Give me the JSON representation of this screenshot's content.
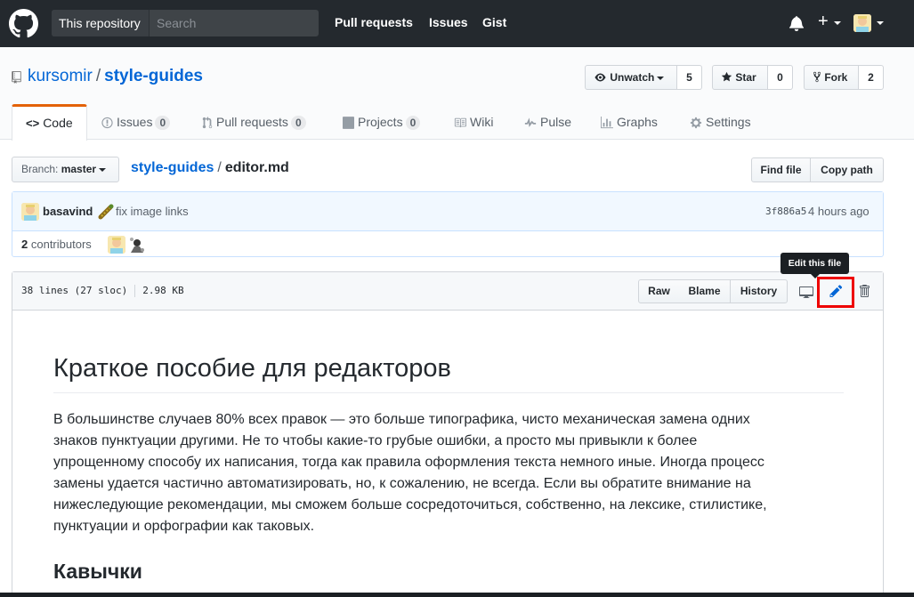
{
  "header": {
    "search_scope": "This repository",
    "search_placeholder": "Search",
    "nav": [
      "Pull requests",
      "Issues",
      "Gist"
    ],
    "plus_label": "+"
  },
  "repo": {
    "owner": "kursomir",
    "separator": "/",
    "name": "style-guides",
    "watch_label": "Unwatch",
    "watch_count": "5",
    "star_label": "Star",
    "star_count": "0",
    "fork_label": "Fork",
    "fork_count": "2"
  },
  "tabs": [
    {
      "label": "Code",
      "icon": "code-icon"
    },
    {
      "label": "Issues",
      "count": "0",
      "icon": "issue-icon"
    },
    {
      "label": "Pull requests",
      "count": "0",
      "icon": "pull-request-icon"
    },
    {
      "label": "Projects",
      "count": "0",
      "icon": "project-icon"
    },
    {
      "label": "Wiki",
      "icon": "book-icon"
    },
    {
      "label": "Pulse",
      "icon": "pulse-icon"
    },
    {
      "label": "Graphs",
      "icon": "graph-icon"
    },
    {
      "label": "Settings",
      "icon": "gear-icon"
    }
  ],
  "file_nav": {
    "branch_prefix": "Branch:",
    "branch": "master",
    "repo": "style-guides",
    "separator": "/",
    "file": "editor.md",
    "find_file": "Find file",
    "copy_path": "Copy path"
  },
  "commit": {
    "author": "basavind",
    "message": "fix image links",
    "sha": "3f886a5",
    "time": "4 hours ago",
    "contributors_count": "2",
    "contributors_label": "contributors"
  },
  "file": {
    "lines": "38 lines (27 sloc)",
    "size": "2.98 KB",
    "raw": "Raw",
    "blame": "Blame",
    "history": "History",
    "tooltip": "Edit this file"
  },
  "markdown": {
    "h1": "Краткое пособие для редакторов",
    "p1_lines": [
      "В большинстве случаев 80% всех правок — это больше типографика, чисто механическая замена одних",
      "знаков пунктуации другими. Не то чтобы какие-то грубые ошибки, а просто мы привыкли к более",
      "упрощенному способу их написания, тогда как правила оформления текста немного иные. Иногда процесс",
      "замены удается частично автоматизировать, но, к сожалению, не всегда. Если вы обратите внимание на",
      "нижеследующие рекомендации, мы сможем больше сосредоточиться, собственно, на лексике, стилистике,",
      "пунктуации и орфографии как таковых."
    ],
    "h2": "Кавычки"
  },
  "colors": {
    "header_bg": "#24292e",
    "link": "#0366d6",
    "tab_accent": "#e36209",
    "highlight": "#ee0000",
    "edit_icon": "#0366d6"
  }
}
